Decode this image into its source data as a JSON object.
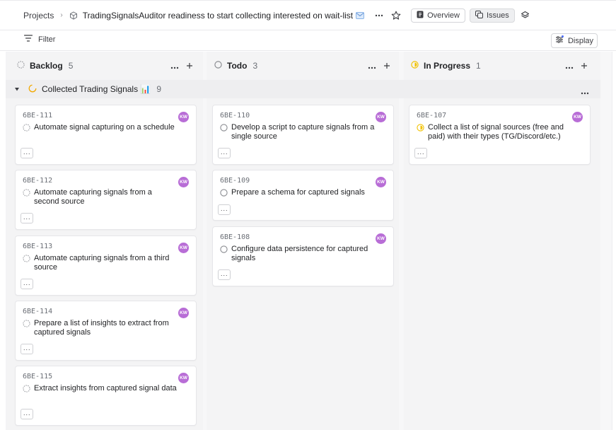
{
  "breadcrumb": {
    "projects": "Projects",
    "project_title": "TradingSignalsAuditor readiness to start collecting interested on wait-list"
  },
  "toolbar": {
    "overview": "Overview",
    "issues": "Issues"
  },
  "filter": {
    "label": "Filter"
  },
  "display": {
    "label": "Display"
  },
  "columns": [
    {
      "title": "Backlog",
      "count": "5"
    },
    {
      "title": "Todo",
      "count": "3"
    },
    {
      "title": "In Progress",
      "count": "1"
    }
  ],
  "group": {
    "title": "Collected Trading Signals 📊",
    "count": "9"
  },
  "cards": {
    "backlog": [
      {
        "id": "6BE-111",
        "title": "Automate signal capturing on a schedule",
        "avatar": "KW"
      },
      {
        "id": "6BE-112",
        "title": "Automate capturing signals from a second source",
        "avatar": "KW"
      },
      {
        "id": "6BE-113",
        "title": "Automate capturing signals from a third source",
        "avatar": "KW"
      },
      {
        "id": "6BE-114",
        "title": "Prepare a list of insights to extract from captured signals",
        "avatar": "KW"
      },
      {
        "id": "6BE-115",
        "title": "Extract insights from captured signal data",
        "avatar": "KW"
      }
    ],
    "todo": [
      {
        "id": "6BE-110",
        "title": "Develop a script to capture signals from a single source",
        "avatar": "KW"
      },
      {
        "id": "6BE-109",
        "title": "Prepare a schema for captured signals",
        "avatar": "KW"
      },
      {
        "id": "6BE-108",
        "title": "Configure data persistence for captured signals",
        "avatar": "KW"
      }
    ],
    "in_progress": [
      {
        "id": "6BE-107",
        "title": "Collect a list of signal sources (free and paid) with their types (TG/Discord/etc.)",
        "avatar": "KW"
      }
    ]
  },
  "colors": {
    "avatar": "#b86dd6",
    "in_progress": "#f2c200",
    "group_icon": "#f2a900"
  },
  "icons": [
    "cube-icon",
    "mail-icon",
    "more-horizontal-icon",
    "star-icon",
    "document-icon",
    "issues-icon",
    "layers-icon",
    "filter-icon",
    "display-icon",
    "backlog-status-icon",
    "todo-status-icon",
    "in-progress-status-icon",
    "plus-icon",
    "collapse-triangle-icon"
  ]
}
